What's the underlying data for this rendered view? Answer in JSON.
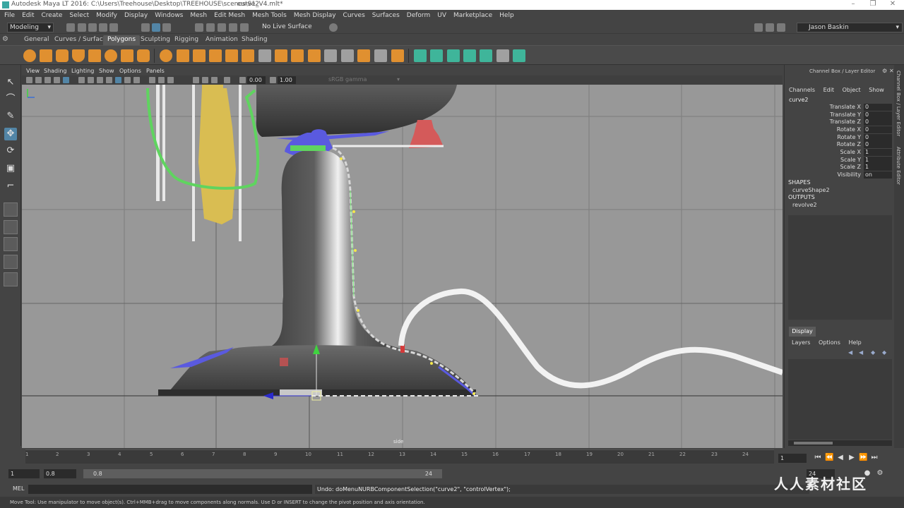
{
  "titlebar": {
    "title": "Autodesk Maya LT 2016: C:\\Users\\Treehouse\\Desktop\\TREEHOUSE\\scenes\\S1_V4.mlt*",
    "selected_object": "curve2",
    "minimize": "–",
    "maximize": "❐",
    "close": "✕"
  },
  "menubar": {
    "items": [
      "File",
      "Edit",
      "Create",
      "Select",
      "Modify",
      "Display",
      "Windows",
      "Mesh",
      "Edit Mesh",
      "Mesh Tools",
      "Mesh Display",
      "Curves",
      "Surfaces",
      "Deform",
      "UV",
      "Marketplace",
      "Help"
    ]
  },
  "statusline": {
    "menu_set": "Modeling",
    "live_surface": "No Live Surface",
    "user": "Jason Baskin"
  },
  "shelf": {
    "tabs": [
      "General",
      "Curves / Surfaces",
      "Polygons",
      "Sculpting",
      "Rigging",
      "Animation",
      "Shading"
    ],
    "active_tab": "Polygons",
    "gear_icon": "⚙"
  },
  "panel": {
    "menu": [
      "View",
      "Shading",
      "Lighting",
      "Show",
      "Options",
      "Panels"
    ],
    "exposure": "0.00",
    "gamma": "1.00",
    "color_space": "sRGB gamma",
    "view_label": "side"
  },
  "timeslider": {
    "ticks": [
      "1",
      "2",
      "3",
      "4",
      "5",
      "6",
      "7",
      "8",
      "9",
      "10",
      "11",
      "12",
      "13",
      "14",
      "15",
      "16",
      "17",
      "18",
      "19",
      "20",
      "21",
      "22",
      "23",
      "24"
    ],
    "current_frame": "1",
    "playback": [
      "⏮",
      "⏪",
      "◀",
      "▶",
      "⏩",
      "⏭"
    ]
  },
  "rangeslider": {
    "start": "1",
    "playback_start": "0.8",
    "range_start": "0.8",
    "range_end": "24",
    "end": "24"
  },
  "commandline": {
    "label": "MEL",
    "result": "Undo: doMenuNURBComponentSelection(\"curve2\", \"controlVertex\");"
  },
  "helpline": {
    "text": "Move Tool: Use manipulator to move object(s). Ctrl+MMB+drag to move components along normals. Use D or INSERT to change the pivot position and axis orientation."
  },
  "channelbox": {
    "title": "Channel Box / Layer Editor",
    "menu": [
      "Channels",
      "Edit",
      "Object",
      "Show"
    ],
    "object": "curve2",
    "channels": [
      {
        "name": "Translate X",
        "value": "0"
      },
      {
        "name": "Translate Y",
        "value": "0"
      },
      {
        "name": "Translate Z",
        "value": "0"
      },
      {
        "name": "Rotate X",
        "value": "0"
      },
      {
        "name": "Rotate Y",
        "value": "0"
      },
      {
        "name": "Rotate Z",
        "value": "0"
      },
      {
        "name": "Scale X",
        "value": "1"
      },
      {
        "name": "Scale Y",
        "value": "1"
      },
      {
        "name": "Scale Z",
        "value": "1"
      },
      {
        "name": "Visibility",
        "value": "on"
      }
    ],
    "shapes_label": "SHAPES",
    "shape": "curveShape2",
    "outputs_label": "OUTPUTS",
    "output": "revolve2",
    "display_tab": "Display",
    "layer_menu": [
      "Layers",
      "Options",
      "Help"
    ]
  },
  "sidetabs": [
    "Channel Box / Layer Editor",
    "Attribute Editor"
  ],
  "watermark": "人人素材社区",
  "colors": {
    "viewport_bg": "#989898",
    "selection_green": "#5fd45f",
    "highlight_blue": "#5285a6",
    "curve_white": "#f2f2f2"
  }
}
